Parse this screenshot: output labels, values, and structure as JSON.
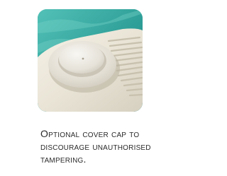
{
  "product_image": {
    "description": "Pool skimmer lid with optional cover cap",
    "icon": "cover-cap-photo"
  },
  "caption": {
    "text": "Optional cover cap to\ndiscourage unauthorised\ntampering."
  },
  "colors": {
    "water": "#3aa79f",
    "deck": "#ece7d8",
    "cap": "#e8e4dc",
    "text": "#2a2a2a"
  }
}
